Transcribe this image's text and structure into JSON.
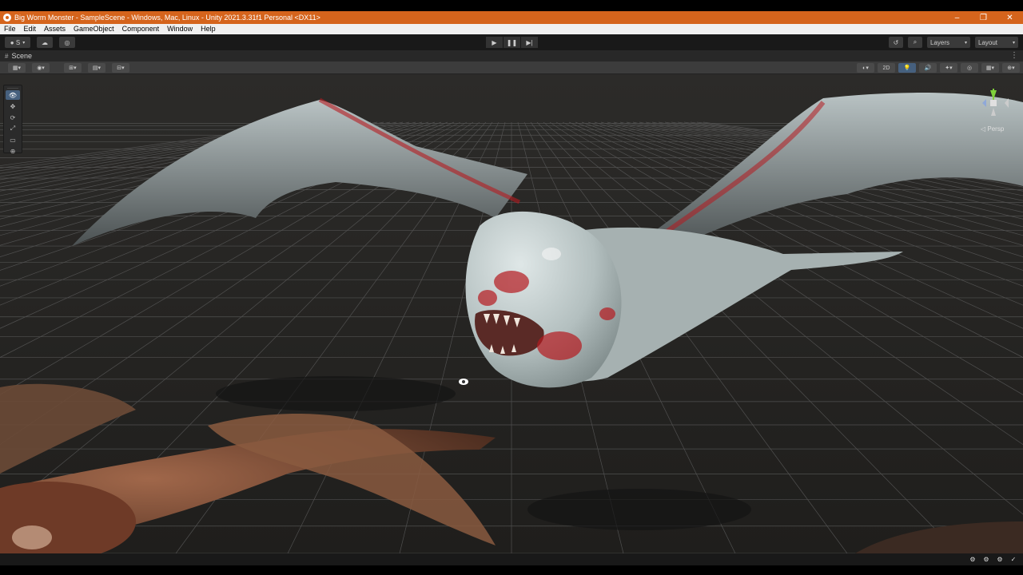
{
  "window": {
    "title": "Big Worm Monster - SampleScene - Windows, Mac, Linux - Unity 2021.3.31f1 Personal <DX11>",
    "controls": {
      "minimize": "–",
      "maximize": "❐",
      "close": "✕"
    }
  },
  "menu": {
    "items": [
      "File",
      "Edit",
      "Assets",
      "GameObject",
      "Component",
      "Window",
      "Help"
    ]
  },
  "toolbar": {
    "account_label": "S",
    "play_icon": "▶",
    "pause_icon": "❚❚",
    "step_icon": "▶|",
    "history_icon": "↺",
    "search_icon": "⌕",
    "layers_label": "Layers",
    "layout_label": "Layout",
    "caret": "▾"
  },
  "scene_tab": {
    "label": "Scene",
    "hash_icon": "#",
    "kebab": "⋮"
  },
  "scene_toolbar": {
    "left_buttons": [
      "▦▾",
      "◉▾",
      "⊞▾",
      "▤▾",
      "⊟▾"
    ],
    "right_buttons": [
      "◐▾",
      "2D",
      "💡",
      "🔊",
      "✦▾",
      "◎",
      "▦▾",
      "⊕▾"
    ],
    "active_right_index": 2
  },
  "tools": {
    "items": [
      "👁",
      "✥",
      "⟳",
      "⤢",
      "▭",
      "⊕"
    ],
    "active_index": 0
  },
  "scene_view": {
    "projection_label": "◁ Persp",
    "accent_colors": {
      "grid": "#5b5b5b",
      "ground": "#262523",
      "creature_skin": "#b7c2c2",
      "blood": "#b51a1f"
    }
  },
  "bottom_bar": {
    "icons": [
      "⚙",
      "⚙",
      "⚙",
      "✓"
    ]
  }
}
